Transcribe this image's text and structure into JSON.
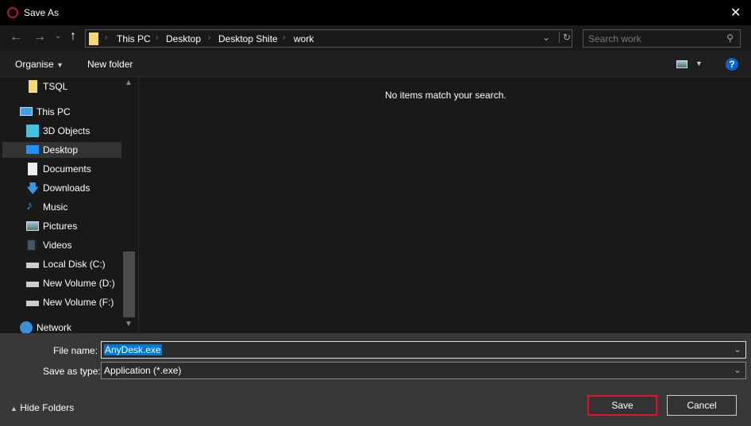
{
  "window": {
    "title": "Save As"
  },
  "nav": {
    "breadcrumb": [
      "This PC",
      "Desktop",
      "Desktop Shite",
      "work"
    ],
    "search_placeholder": "Search work"
  },
  "toolbar": {
    "organise": "Organise",
    "new_folder": "New folder",
    "help": "?"
  },
  "sidebar": {
    "items": [
      {
        "label": "TSQL",
        "icon": "folder-icon"
      },
      {
        "label": "This PC",
        "icon": "computer-icon"
      },
      {
        "label": "3D Objects",
        "icon": "cube-icon"
      },
      {
        "label": "Desktop",
        "icon": "desktop-icon",
        "selected": true
      },
      {
        "label": "Documents",
        "icon": "document-icon"
      },
      {
        "label": "Downloads",
        "icon": "download-icon"
      },
      {
        "label": "Music",
        "icon": "music-icon"
      },
      {
        "label": "Pictures",
        "icon": "pictures-icon"
      },
      {
        "label": "Videos",
        "icon": "videos-icon"
      },
      {
        "label": "Local Disk (C:)",
        "icon": "drive-icon"
      },
      {
        "label": "New Volume (D:)",
        "icon": "drive-icon"
      },
      {
        "label": "New Volume (F:)",
        "icon": "drive-icon"
      },
      {
        "label": "Network",
        "icon": "network-icon"
      }
    ]
  },
  "content": {
    "empty_message": "No items match your search."
  },
  "form": {
    "file_name_label": "File name:",
    "file_name": "AnyDesk.exe",
    "type_label": "Save as type:",
    "type": "Application (*.exe)"
  },
  "footer": {
    "hide_folders": "Hide Folders",
    "save": "Save",
    "cancel": "Cancel"
  },
  "colors": {
    "accent": "#0078d7",
    "highlight_border": "#e81123"
  }
}
